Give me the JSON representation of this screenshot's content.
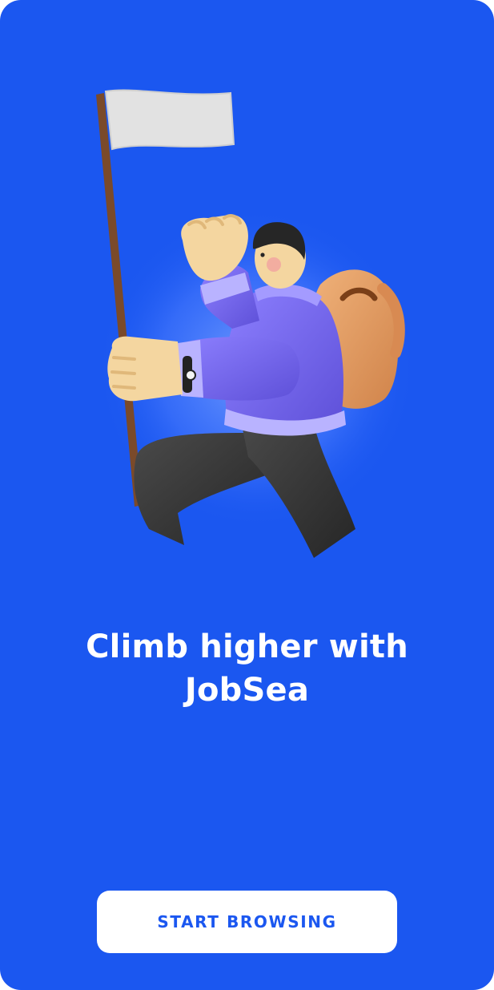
{
  "onboarding": {
    "headline": "Climb higher with JobSea",
    "cta_label": "START BROWSING"
  },
  "illustration": {
    "subject": "hiker-with-flag-and-backpack",
    "colors": {
      "background": "#1b57f0",
      "flag": "#e2e2e2",
      "pole": "#7a4a2a",
      "skin": "#f4d6a0",
      "jacket": "#7b6cf0",
      "jacket_cuff": "#b9b3ff",
      "pants": "#3c3c3c",
      "backpack": "#e7a060",
      "hair": "#262626"
    }
  },
  "theme": {
    "accent": "#1b57f0",
    "button_bg": "#ffffff",
    "text_light": "#ffffff"
  }
}
